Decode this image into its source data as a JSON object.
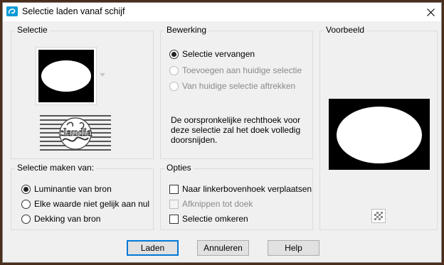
{
  "window": {
    "title": "Selectie laden vanaf schijf"
  },
  "groups": {
    "selectie": {
      "label": "Selectie"
    },
    "bewerking": {
      "label": "Bewerking",
      "options": [
        {
          "label": "Selectie vervangen",
          "checked": true,
          "disabled": false
        },
        {
          "label": "Toevoegen aan huidige selectie",
          "checked": false,
          "disabled": true
        },
        {
          "label": "Van huidige selectie aftrekken",
          "checked": false,
          "disabled": true
        }
      ],
      "description": "De oorspronkelijke rechthoek voor deze selectie zal het doek volledig doorsnijden."
    },
    "voorbeeld": {
      "label": "Voorbeeld"
    },
    "selectie_maken": {
      "label": "Selectie maken van:",
      "options": [
        {
          "label": "Luminantie van bron",
          "checked": true
        },
        {
          "label": "Elke waarde niet gelijk aan nul",
          "checked": false
        },
        {
          "label": "Dekking van bron",
          "checked": false
        }
      ]
    },
    "opties": {
      "label": "Opties",
      "checks": [
        {
          "label": "Naar linkerbovenhoek verplaatsen",
          "checked": false,
          "disabled": false
        },
        {
          "label": "Afknippen tot doek",
          "checked": false,
          "disabled": true
        },
        {
          "label": "Selectie omkeren",
          "checked": false,
          "disabled": false
        }
      ]
    }
  },
  "watermark": {
    "text": "claudia"
  },
  "buttons": {
    "load": "Laden",
    "cancel": "Annuleren",
    "help": "Help"
  },
  "colors": {
    "accent": "#0078d7",
    "app_icon": "#0a9bd6",
    "frame": "#4a2e1c"
  }
}
